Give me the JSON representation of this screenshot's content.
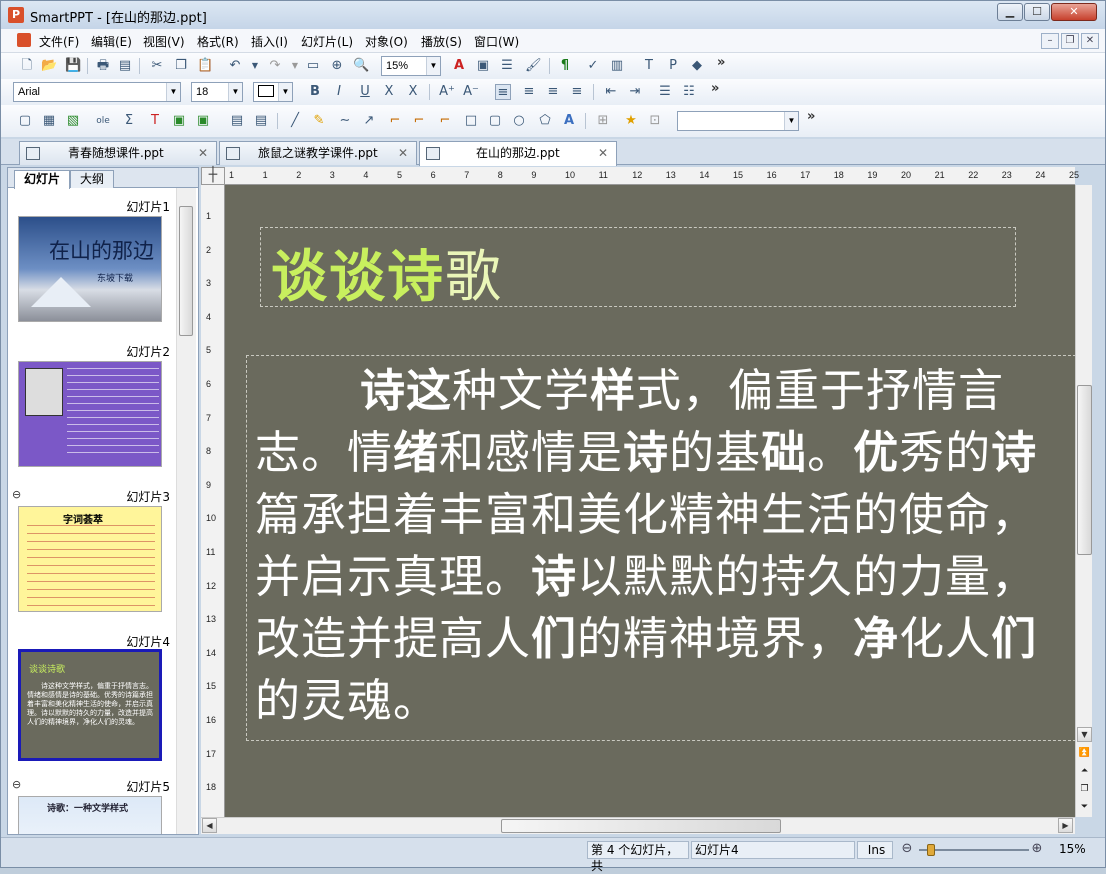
{
  "window": {
    "title": "SmartPPT - [在山的那边.ppt]"
  },
  "menubar": {
    "items": [
      "文件(F)",
      "编辑(E)",
      "视图(V)",
      "格式(R)",
      "插入(I)",
      "幻灯片(L)",
      "对象(O)",
      "播放(S)",
      "窗口(W)"
    ]
  },
  "toolbar1": {
    "zoom_value": "15%"
  },
  "toolbar2": {
    "font_name": "Arial",
    "font_size": "18"
  },
  "doc_tabs": [
    {
      "label": "青春随想课件.ppt",
      "active": false
    },
    {
      "label": "旅鼠之谜教学课件.ppt",
      "active": false
    },
    {
      "label": "在山的那边.ppt",
      "active": true
    }
  ],
  "left_panel": {
    "tabs": [
      "幻灯片",
      "大纲"
    ],
    "slides": [
      {
        "label": "幻灯片1",
        "thumb_title": "在山的那边",
        "thumb_sub": "东坡下载"
      },
      {
        "label": "幻灯片2"
      },
      {
        "label": "幻灯片3",
        "thumb_title": "字词荟萃"
      },
      {
        "label": "幻灯片4",
        "thumb_title": "谈谈诗歌",
        "thumb_body": "诗这种文学样式，偏重于抒情言志。情绪和感情是诗的基础。优秀的诗篇承担着丰富和美化精神生活的使命，并启示真理。诗以默默的持久的力量，改造并提高人们的精神境界，净化人们的灵魂。"
      },
      {
        "label": "幻灯片5",
        "thumb_title": "诗歌：一种文学样式"
      }
    ]
  },
  "slide": {
    "title_bold": "谈谈诗",
    "title_plain": "歌",
    "body": [
      {
        "t": "诗这",
        "b": true
      },
      {
        "t": "种文学",
        "b": false
      },
      {
        "t": "样",
        "b": true
      },
      {
        "t": "式，偏重于抒情言志。情",
        "b": false
      },
      {
        "t": "绪",
        "b": true
      },
      {
        "t": "和感情是",
        "b": false
      },
      {
        "t": "诗",
        "b": true
      },
      {
        "t": "的基",
        "b": false
      },
      {
        "t": "础",
        "b": true
      },
      {
        "t": "。",
        "b": false
      },
      {
        "t": "优",
        "b": true
      },
      {
        "t": "秀的",
        "b": false
      },
      {
        "t": "诗",
        "b": true
      },
      {
        "t": "篇承担着丰富和美化精神生活的使命，并启示真理。",
        "b": false
      },
      {
        "t": "诗",
        "b": true
      },
      {
        "t": "以默默的持久的力量，改造并提高人",
        "b": false
      },
      {
        "t": "们",
        "b": true
      },
      {
        "t": "的精神境界，",
        "b": false
      },
      {
        "t": "净",
        "b": true
      },
      {
        "t": "化人",
        "b": false
      },
      {
        "t": "们",
        "b": true
      },
      {
        "t": "的灵魂。",
        "b": false
      }
    ]
  },
  "ruler": {
    "h": [
      "1",
      "1",
      "2",
      "3",
      "4",
      "5",
      "6",
      "7",
      "8",
      "9",
      "10",
      "11",
      "12",
      "13",
      "14",
      "15",
      "16",
      "17",
      "18",
      "19",
      "20",
      "21",
      "22",
      "23",
      "24",
      "25"
    ],
    "v": [
      "1",
      "2",
      "3",
      "4",
      "5",
      "6",
      "7",
      "8",
      "9",
      "10",
      "11",
      "12",
      "13",
      "14",
      "15",
      "16",
      "17",
      "18"
    ]
  },
  "status": {
    "slide_info": "第 4 个幻灯片，共",
    "slide_name": "幻灯片4",
    "mode": "Ins",
    "zoom": "15%"
  }
}
